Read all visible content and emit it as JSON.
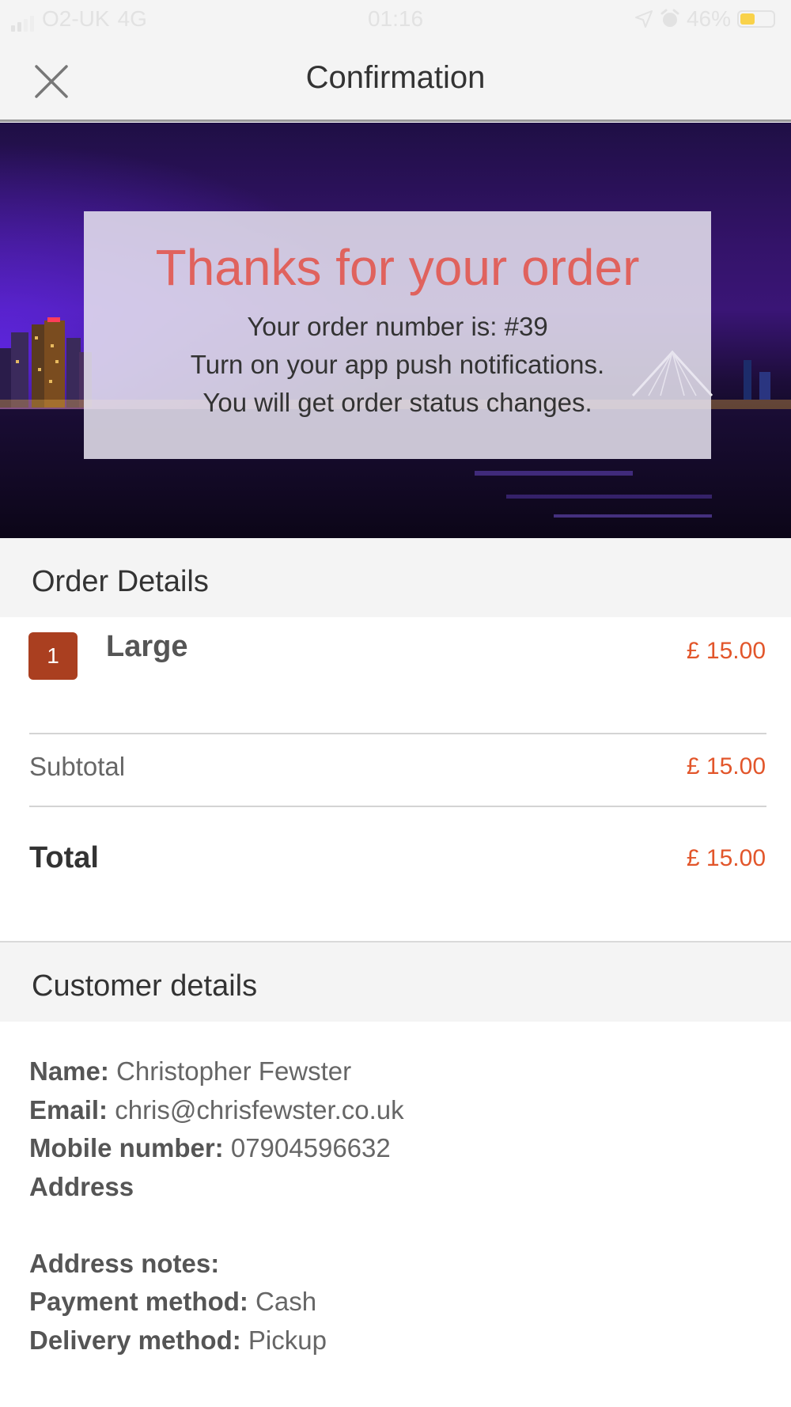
{
  "status_bar": {
    "carrier": "O2-UK",
    "network": "4G",
    "time": "01:16",
    "battery": "46%",
    "battery_level": 0.46,
    "icons": [
      "signal-icon",
      "location-arrow-icon",
      "alarm-icon",
      "battery-icon"
    ]
  },
  "header": {
    "title": "Confirmation",
    "close_icon": "close-icon"
  },
  "hero": {
    "title": "Thanks for your order",
    "order_number_line": "Your order number is: #39",
    "push_line": "Turn on your app push notifications.",
    "status_line": "You will get order status changes."
  },
  "order_details": {
    "heading": "Order Details",
    "items": [
      {
        "quantity": "1",
        "name": "Large",
        "price": "£ 15.00"
      }
    ],
    "subtotal_label": "Subtotal",
    "subtotal_value": "£ 15.00",
    "total_label": "Total",
    "total_value": "£ 15.00"
  },
  "customer_details": {
    "heading": "Customer details",
    "name_label": "Name:",
    "name_value": "Christopher Fewster",
    "email_label": "Email:",
    "email_value": "chris@chrisfewster.co.uk",
    "mobile_label": "Mobile number:",
    "mobile_value": "07904596632",
    "address_label": "Address",
    "address_notes_label": "Address notes:",
    "payment_label": "Payment method:",
    "payment_value": "Cash",
    "delivery_label": "Delivery method:",
    "delivery_value": "Pickup"
  },
  "colors": {
    "accent_price": "#e2562b",
    "hero_title": "#e0625d",
    "badge": "#aa3f20",
    "battery_fill": "#f9d24a"
  }
}
